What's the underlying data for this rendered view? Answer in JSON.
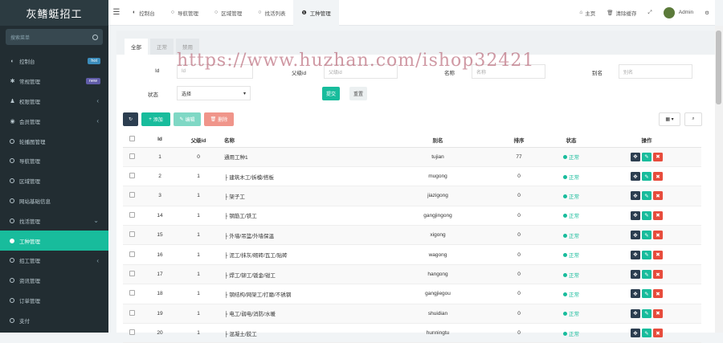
{
  "app": {
    "title": "灰鳍蜓招工"
  },
  "sidebar": {
    "search_placeholder": "搜索菜单",
    "items": [
      {
        "label": "控制台",
        "badge": "hot",
        "badge_color": "#3c8dbc",
        "icon": "dashboard-icon"
      },
      {
        "label": "常规管理",
        "badge": "new",
        "badge_color": "#605ca8",
        "icon": "cogs-icon"
      },
      {
        "label": "权限管理",
        "chevron": "‹",
        "icon": "users-icon"
      },
      {
        "label": "会员管理",
        "chevron": "‹",
        "icon": "user-circle-icon"
      },
      {
        "label": "轮播图管理"
      },
      {
        "label": "导航管理"
      },
      {
        "label": "区域管理"
      },
      {
        "label": "网站基础信息"
      },
      {
        "label": "找活管理",
        "chevron": "⌄"
      },
      {
        "label": "工种管理",
        "active": true
      },
      {
        "label": "招工管理",
        "chevron": "‹"
      },
      {
        "label": "资讯管理"
      },
      {
        "label": "订单管理"
      },
      {
        "label": "支付"
      }
    ]
  },
  "topbar": {
    "tabs": [
      {
        "label": "控制台",
        "icon": "dashboard-icon"
      },
      {
        "label": "导航管理",
        "icon": "circle-icon"
      },
      {
        "label": "区域管理",
        "icon": "circle-icon"
      },
      {
        "label": "找活列表",
        "icon": "circle-icon"
      },
      {
        "label": "工种管理",
        "icon": "info-circle-icon",
        "active": true
      }
    ],
    "home": "主页",
    "clear_cache": "清除缓存",
    "user": "Admin"
  },
  "page_tabs": [
    "全部",
    "正常",
    "禁用"
  ],
  "filter": {
    "id_label": "Id",
    "id_placeholder": "Id",
    "pid_label": "父级id",
    "pid_placeholder": "父级id",
    "name_label": "名称",
    "name_placeholder": "名称",
    "alias_label": "别名",
    "alias_placeholder": "别名",
    "status_label": "状态",
    "status_value": "选择",
    "submit": "提交",
    "reset": "重置"
  },
  "toolbar": {
    "add": "添加",
    "edit": "编辑",
    "delete": "删除"
  },
  "watermark": "https://www.huzhan.com/ishop32421",
  "table": {
    "headers": [
      "Id",
      "父级id",
      "名称",
      "别名",
      "排序",
      "状态",
      "操作"
    ],
    "rows": [
      {
        "id": "1",
        "pid": "0",
        "name": "通用工种1",
        "alias": "tujian",
        "sort": "77",
        "status": "正常"
      },
      {
        "id": "2",
        "pid": "1",
        "name": "├ 建筑木工/拆模/搭板",
        "alias": "mugong",
        "sort": "0",
        "status": "正常"
      },
      {
        "id": "3",
        "pid": "1",
        "name": "├ 架子工",
        "alias": "jiazigong",
        "sort": "0",
        "status": "正常"
      },
      {
        "id": "14",
        "pid": "1",
        "name": "├ 钢筋工/铁工",
        "alias": "gangjingong",
        "sort": "0",
        "status": "正常"
      },
      {
        "id": "15",
        "pid": "1",
        "name": "├ 外墙/吊篮/外墙保温",
        "alias": "xigong",
        "sort": "0",
        "status": "正常"
      },
      {
        "id": "16",
        "pid": "1",
        "name": "├ 泥工/抹灰/砌砖/瓦工/贴砖",
        "alias": "wagong",
        "sort": "0",
        "status": "正常"
      },
      {
        "id": "17",
        "pid": "1",
        "name": "├ 焊工/铆工/钣金/钳工",
        "alias": "hangong",
        "sort": "0",
        "status": "正常"
      },
      {
        "id": "18",
        "pid": "1",
        "name": "├ 钢结构/网架工/打磨/不锈钢",
        "alias": "gangjiegou",
        "sort": "0",
        "status": "正常"
      },
      {
        "id": "19",
        "pid": "1",
        "name": "├ 电工/弱电/消防/水暖",
        "alias": "shuidian",
        "sort": "0",
        "status": "正常"
      },
      {
        "id": "20",
        "pid": "1",
        "name": "├ 混凝土/胶工",
        "alias": "hunningtu",
        "sort": "0",
        "status": "正常"
      }
    ]
  }
}
